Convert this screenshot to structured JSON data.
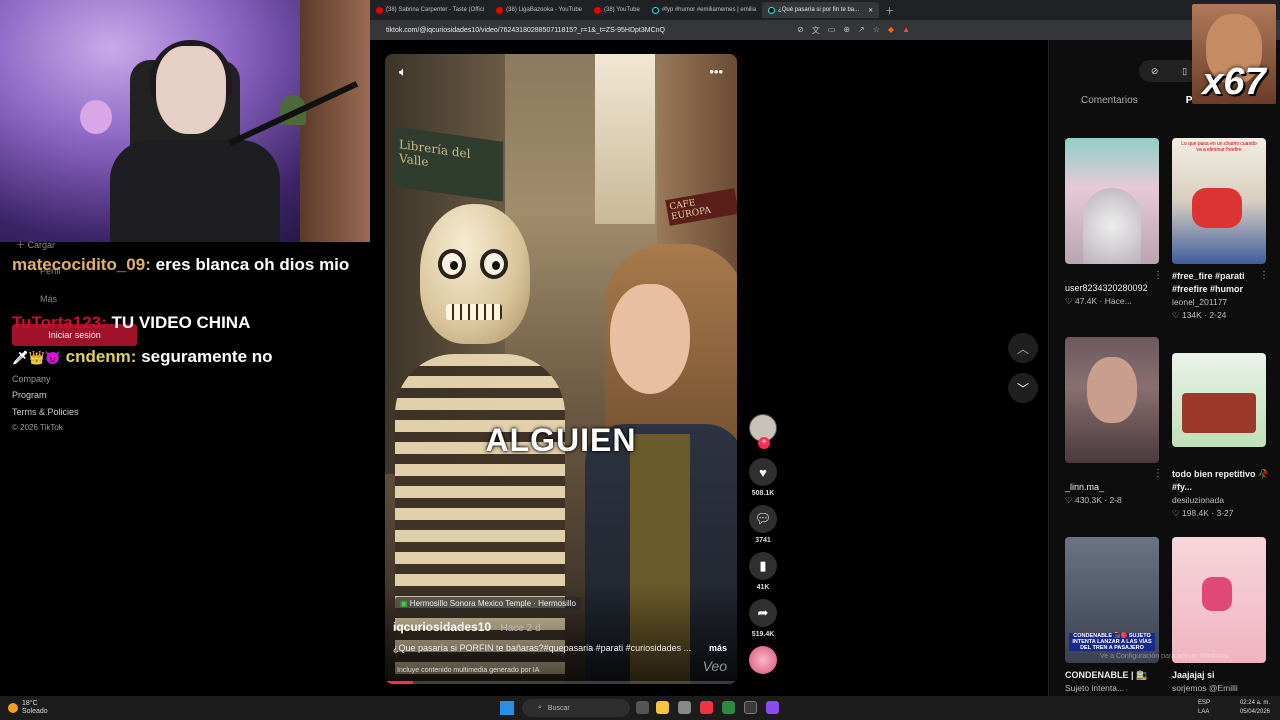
{
  "browser": {
    "tabs": [
      {
        "title": "(38) Sabrina Carpenter - Taste (Offici",
        "icon": "youtube-icon"
      },
      {
        "title": "(38) LigaBazooka - YouTube",
        "icon": "youtube-icon"
      },
      {
        "title": "(38) YouTube",
        "icon": "youtube-icon"
      },
      {
        "title": "#fyp #humor #emiliamemes | emilia",
        "icon": "tiktok-icon"
      },
      {
        "title": "¿Qué pasaría si por fin te ba...",
        "icon": "tiktok-icon",
        "active": true
      }
    ],
    "url": "tiktok.com/@iqcuriosidades10/video/7624318028850711815?_r=1&_t=ZS-95HDpt3MCnQ"
  },
  "chat": {
    "sidebar_items": [
      "Cargar",
      "Perfil",
      "Más"
    ],
    "login_label": "Iniciar sesión",
    "messages": [
      {
        "user": "matecocidito_09:",
        "text": "eres blanca oh dios mio"
      },
      {
        "user": "TuTorta123:",
        "text": "TU VIDEO CHINA"
      },
      {
        "user": "cndenm:",
        "text": "seguramente no",
        "badges": "🗡👑😈"
      }
    ],
    "footer": [
      "Company",
      "Program",
      "Terms & Policies",
      "© 2026 TikTok"
    ]
  },
  "video": {
    "shop_sign": "Librería del Valle",
    "shop_sign_right": "CAFE EUROPA",
    "overlay_text": "ALGUIEN",
    "location": "Hermosillo Sonora Mexico Temple · Hermosillo",
    "author": "iqcuriosidades10",
    "ago": "· Hace 2 d",
    "description": "¿Que pasaría si PORFIN te bañaras?#quepasaria #parati #curiosidades ...",
    "more": "más",
    "ai_note": "Incluye contenido multimedia generado por IA",
    "watermark": "Veo",
    "progress": 0.08
  },
  "actions": {
    "likes": "508.1K",
    "comments": "3741",
    "saves": "41K",
    "shares": "519.4K"
  },
  "right_panel": {
    "tabs": [
      "Comentarios",
      "Podr"
    ],
    "cards": [
      {
        "caption": "",
        "author": "user8234320280092",
        "stats": "♡ 47.4K · Hace..."
      },
      {
        "caption": "#free_fire #parati #freefire #humor",
        "author": "leonel_201177",
        "stats": "♡ 134K · 2-24"
      },
      {
        "caption": "",
        "author": "_linn.ma_",
        "stats": "♡ 430.3K · 2-8"
      },
      {
        "caption": "todo bien repetitivo 🥀 #fy...",
        "author": "desiluzionada",
        "stats": "♡ 198.4K · 3-27"
      },
      {
        "caption": "CONDENABLE | 🚉",
        "author": "",
        "stats": "Sujeto intenta..."
      },
      {
        "caption": "Jaajajaj si",
        "author": "",
        "stats": "sorjemos @Emilli"
      }
    ],
    "thumb_texts": {
      "thumb5": "CONDENABLE 🚂🔴 SUJETO INTENTA LANZAR A LAS VÍAS DEL TREN A PASAJERO",
      "thumb2": "Lo que pasa en un chamo cuando va a eliminar freefire"
    }
  },
  "meme_overlay": "x67",
  "taskbar": {
    "weather_temp": "18°C",
    "weather_text": "Soleado",
    "search": "Buscar",
    "lang_1": "ESP",
    "lang_2": "LAA",
    "time": "02:24 a. m.",
    "date": "05/04/2026",
    "activate": "Ve a Configuración para activar Windows."
  }
}
